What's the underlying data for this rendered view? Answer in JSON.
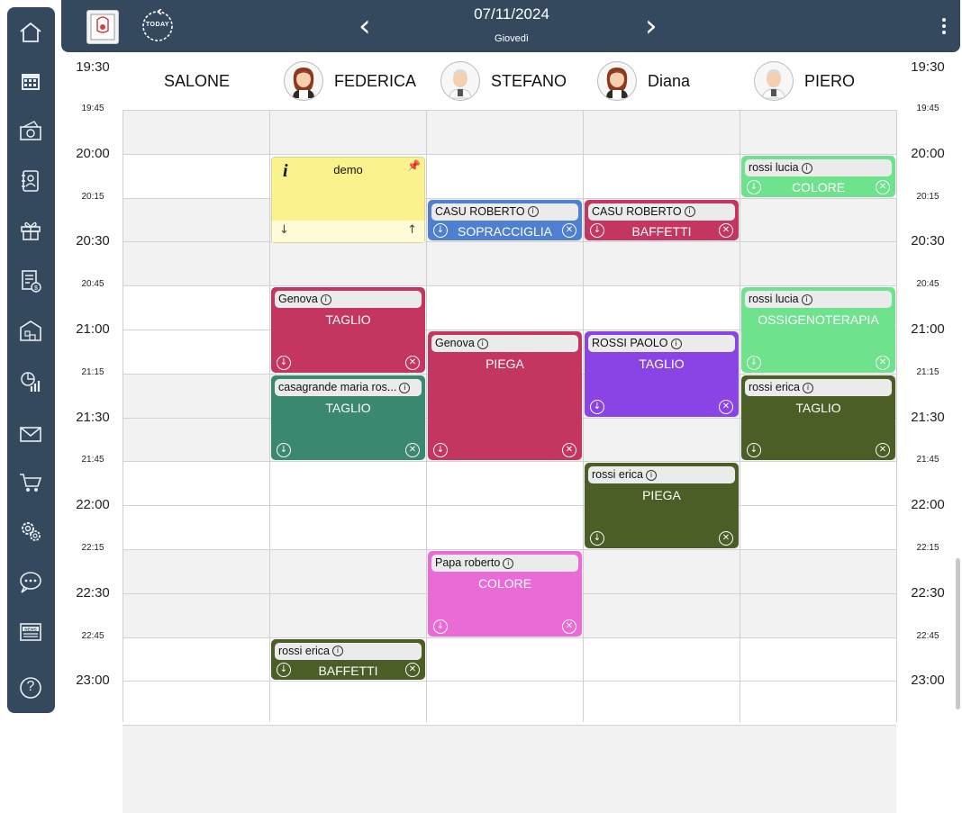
{
  "toolbar": {
    "date": "07/11/2024",
    "weekday": "Giovedì",
    "prev_label": "‹",
    "next_label": "›",
    "today_label": "TODAY"
  },
  "sidebar": {
    "items": [
      {
        "icon": "home-icon"
      },
      {
        "icon": "calendar-icon"
      },
      {
        "icon": "cash-icon"
      },
      {
        "icon": "address-book-icon"
      },
      {
        "icon": "gift-icon"
      },
      {
        "icon": "invoice-icon"
      },
      {
        "icon": "warehouse-icon"
      },
      {
        "icon": "chart-icon"
      },
      {
        "icon": "mail-icon"
      },
      {
        "icon": "cart-icon"
      },
      {
        "icon": "settings-icon"
      },
      {
        "icon": "chat-icon"
      },
      {
        "icon": "news-icon"
      },
      {
        "icon": "help-icon",
        "label": "?"
      }
    ]
  },
  "columns": [
    {
      "name": "SALONE",
      "avatar": false
    },
    {
      "name": "FEDERICA",
      "avatar": "female"
    },
    {
      "name": "STEFANO",
      "avatar": "male"
    },
    {
      "name": "Diana",
      "avatar": "female"
    },
    {
      "name": "PIERO",
      "avatar": "male"
    }
  ],
  "time_labels": {
    "top_left": "19:30",
    "top_right": "19:30",
    "rows": [
      "19:45",
      "20:00",
      "20:15",
      "20:30",
      "20:45",
      "21:00",
      "21:15",
      "21:30",
      "21:45",
      "22:00",
      "22:15",
      "22:30",
      "22:45",
      "23:00"
    ]
  },
  "note": {
    "icon": "i",
    "text": "demo",
    "foot_left": "↓",
    "foot_right": "↑"
  },
  "appointments": [
    {
      "client": "Genova",
      "service": "TAGLIO",
      "col": 1,
      "start": "20:45",
      "end": "21:15",
      "color": "#c4365f"
    },
    {
      "client": "casagrande maria ros...",
      "service": "TAGLIO",
      "col": 1,
      "start": "21:15",
      "end": "21:45",
      "color": "#3b8870"
    },
    {
      "client": "rossi erica",
      "service": "BAFFETTI",
      "col": 1,
      "start": "22:45",
      "end": "23:00",
      "color": "#4a5e26"
    },
    {
      "client": "CASU ROBERTO",
      "service": "SOPRACCIGLIA",
      "col": 2,
      "start": "20:15",
      "end": "20:30",
      "color": "#4e7fd0"
    },
    {
      "client": "Genova",
      "service": "PIEGA",
      "col": 2,
      "start": "21:00",
      "end": "21:45",
      "color": "#c4365f"
    },
    {
      "client": "Papa roberto",
      "service": "COLORE",
      "col": 2,
      "start": "22:15",
      "end": "22:45",
      "color": "#ea6ad6"
    },
    {
      "client": "CASU ROBERTO",
      "service": "BAFFETTI",
      "col": 3,
      "start": "20:15",
      "end": "20:30",
      "color": "#c4365f"
    },
    {
      "client": "ROSSI PAOLO",
      "service": "TAGLIO",
      "col": 3,
      "start": "21:00",
      "end": "21:30",
      "color": "#8a44e6"
    },
    {
      "client": "rossi erica",
      "service": "PIEGA",
      "col": 3,
      "start": "21:45",
      "end": "22:15",
      "color": "#4a5e26"
    },
    {
      "client": "rossi lucia",
      "service": "COLORE",
      "col": 4,
      "start": "20:00",
      "end": "20:15",
      "color": "#6fe28e"
    },
    {
      "client": "rossi lucia",
      "service": "OSSIGENOTERAPIA",
      "col": 4,
      "start": "20:45",
      "end": "21:15",
      "color": "#6fe28e"
    },
    {
      "client": "rossi erica",
      "service": "TAGLIO",
      "col": 4,
      "start": "21:15",
      "end": "21:45",
      "color": "#4a5e26"
    }
  ]
}
